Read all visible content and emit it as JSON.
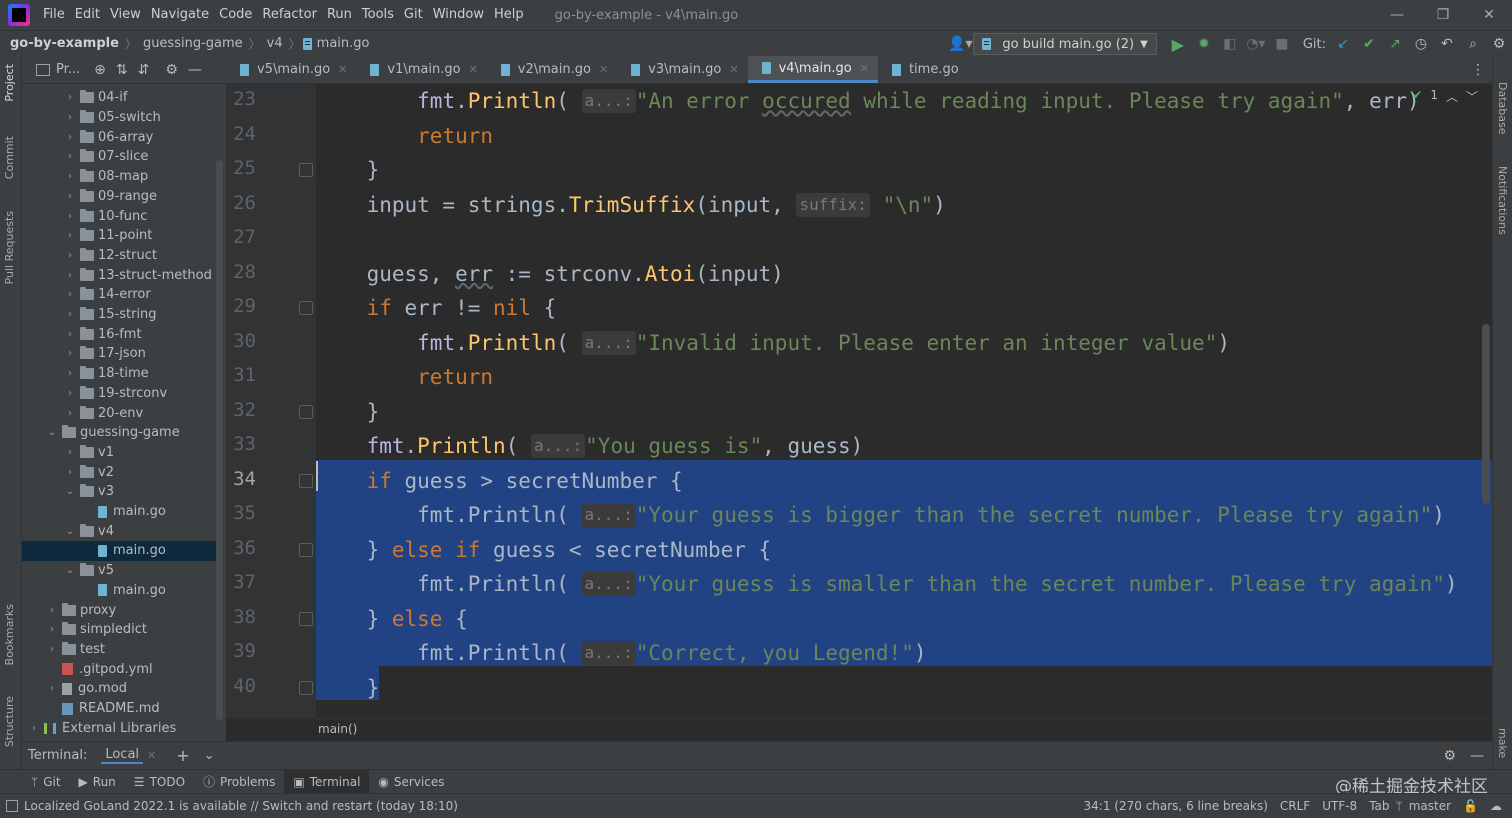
{
  "menubar": {
    "items": [
      "File",
      "Edit",
      "View",
      "Navigate",
      "Code",
      "Refactor",
      "Run",
      "Tools",
      "Git",
      "Window",
      "Help"
    ],
    "window_title": "go-by-example - v4\\main.go"
  },
  "navbar": {
    "breadcrumb": [
      "go-by-example",
      "guessing-game",
      "v4",
      "main.go"
    ],
    "run_config": "go build main.go (2)",
    "git_label": "Git:"
  },
  "left_strip": [
    "Project",
    "Commit",
    "Pull Requests",
    "Bookmarks",
    "Structure"
  ],
  "right_strip": [
    "Database",
    "Notifications",
    "make"
  ],
  "project": {
    "title": "Pr...",
    "tree": [
      {
        "label": "04-if",
        "type": "folder",
        "depth": 2,
        "arrow": "›"
      },
      {
        "label": "05-switch",
        "type": "folder",
        "depth": 2,
        "arrow": "›"
      },
      {
        "label": "06-array",
        "type": "folder",
        "depth": 2,
        "arrow": "›"
      },
      {
        "label": "07-slice",
        "type": "folder",
        "depth": 2,
        "arrow": "›"
      },
      {
        "label": "08-map",
        "type": "folder",
        "depth": 2,
        "arrow": "›"
      },
      {
        "label": "09-range",
        "type": "folder",
        "depth": 2,
        "arrow": "›"
      },
      {
        "label": "10-func",
        "type": "folder",
        "depth": 2,
        "arrow": "›"
      },
      {
        "label": "11-point",
        "type": "folder",
        "depth": 2,
        "arrow": "›"
      },
      {
        "label": "12-struct",
        "type": "folder",
        "depth": 2,
        "arrow": "›"
      },
      {
        "label": "13-struct-method",
        "type": "folder",
        "depth": 2,
        "arrow": "›"
      },
      {
        "label": "14-error",
        "type": "folder",
        "depth": 2,
        "arrow": "›"
      },
      {
        "label": "15-string",
        "type": "folder",
        "depth": 2,
        "arrow": "›"
      },
      {
        "label": "16-fmt",
        "type": "folder",
        "depth": 2,
        "arrow": "›"
      },
      {
        "label": "17-json",
        "type": "folder",
        "depth": 2,
        "arrow": "›"
      },
      {
        "label": "18-time",
        "type": "folder",
        "depth": 2,
        "arrow": "›"
      },
      {
        "label": "19-strconv",
        "type": "folder",
        "depth": 2,
        "arrow": "›"
      },
      {
        "label": "20-env",
        "type": "folder",
        "depth": 2,
        "arrow": "›"
      },
      {
        "label": "guessing-game",
        "type": "folder",
        "depth": 1,
        "arrow": "⌄"
      },
      {
        "label": "v1",
        "type": "folder",
        "depth": 2,
        "arrow": "›"
      },
      {
        "label": "v2",
        "type": "folder",
        "depth": 2,
        "arrow": "›"
      },
      {
        "label": "v3",
        "type": "folder",
        "depth": 2,
        "arrow": "⌄"
      },
      {
        "label": "main.go",
        "type": "go",
        "depth": 3,
        "arrow": ""
      },
      {
        "label": "v4",
        "type": "folder",
        "depth": 2,
        "arrow": "⌄"
      },
      {
        "label": "main.go",
        "type": "go",
        "depth": 3,
        "arrow": "",
        "selected": true
      },
      {
        "label": "v5",
        "type": "folder",
        "depth": 2,
        "arrow": "⌄"
      },
      {
        "label": "main.go",
        "type": "go",
        "depth": 3,
        "arrow": ""
      },
      {
        "label": "proxy",
        "type": "folder",
        "depth": 1,
        "arrow": "›"
      },
      {
        "label": "simpledict",
        "type": "folder",
        "depth": 1,
        "arrow": "›"
      },
      {
        "label": "test",
        "type": "folder",
        "depth": 1,
        "arrow": "›"
      },
      {
        "label": ".gitpod.yml",
        "type": "yml",
        "depth": 1,
        "arrow": ""
      },
      {
        "label": "go.mod",
        "type": "mod",
        "depth": 1,
        "arrow": "›"
      },
      {
        "label": "README.md",
        "type": "md",
        "depth": 1,
        "arrow": ""
      },
      {
        "label": "External Libraries",
        "type": "lib",
        "depth": 0,
        "arrow": "›"
      }
    ]
  },
  "tabs": [
    {
      "label": "v5\\main.go"
    },
    {
      "label": "v1\\main.go"
    },
    {
      "label": "v2\\main.go"
    },
    {
      "label": "v3\\main.go"
    },
    {
      "label": "v4\\main.go",
      "active": true
    },
    {
      "label": "time.go"
    }
  ],
  "editor": {
    "line_numbers": [
      "23",
      "24",
      "25",
      "26",
      "27",
      "28",
      "29",
      "30",
      "31",
      "32",
      "33",
      "34",
      "35",
      "36",
      "37",
      "38",
      "39",
      "40"
    ],
    "current_line": "34",
    "inspection_count": "1",
    "breadcrumb": "main()",
    "lines": [
      [
        {
          "t": "        "
        },
        {
          "t": "fmt",
          "c": "pkg"
        },
        {
          "t": "."
        },
        {
          "t": "Println",
          "c": "fn"
        },
        {
          "t": "( "
        },
        {
          "t": "a...:",
          "c": "hint"
        },
        {
          "t": "\"An error ",
          "c": "str"
        },
        {
          "t": "occured",
          "c": "str typo"
        },
        {
          "t": " while reading input. Please try again\"",
          "c": "str"
        },
        {
          "t": ", err)"
        }
      ],
      [
        {
          "t": "        "
        },
        {
          "t": "return",
          "c": "kw"
        }
      ],
      [
        {
          "t": "    }"
        }
      ],
      [
        {
          "t": "    input = strings."
        },
        {
          "t": "TrimSuffix",
          "c": "fn"
        },
        {
          "t": "(input, "
        },
        {
          "t": "suffix:",
          "c": "hint"
        },
        {
          "t": " "
        },
        {
          "t": "\"\\n\"",
          "c": "str"
        },
        {
          "t": ")"
        }
      ],
      [
        {
          "t": ""
        }
      ],
      [
        {
          "t": "    guess, "
        },
        {
          "t": "err",
          "c": "typo"
        },
        {
          "t": " := strconv."
        },
        {
          "t": "Atoi",
          "c": "fn"
        },
        {
          "t": "(input)"
        }
      ],
      [
        {
          "t": "    "
        },
        {
          "t": "if",
          "c": "kw"
        },
        {
          "t": " err != "
        },
        {
          "t": "nil",
          "c": "kw"
        },
        {
          "t": " {"
        }
      ],
      [
        {
          "t": "        "
        },
        {
          "t": "fmt",
          "c": "pkg"
        },
        {
          "t": "."
        },
        {
          "t": "Println",
          "c": "fn"
        },
        {
          "t": "( "
        },
        {
          "t": "a...:",
          "c": "hint"
        },
        {
          "t": "\"Invalid input. Please enter an integer value\"",
          "c": "str"
        },
        {
          "t": ")"
        }
      ],
      [
        {
          "t": "        "
        },
        {
          "t": "return",
          "c": "kw"
        }
      ],
      [
        {
          "t": "    }"
        }
      ],
      [
        {
          "t": "    "
        },
        {
          "t": "fmt",
          "c": "pkg"
        },
        {
          "t": "."
        },
        {
          "t": "Println",
          "c": "fn"
        },
        {
          "t": "( "
        },
        {
          "t": "a...:",
          "c": "hint"
        },
        {
          "t": "\"You guess is\"",
          "c": "str"
        },
        {
          "t": ", guess)"
        }
      ],
      [
        {
          "t": "    "
        },
        {
          "t": "if",
          "c": "kw"
        },
        {
          "t": " guess > secretNumber {"
        }
      ],
      [
        {
          "t": "        fmt."
        },
        {
          "t": "Println",
          "c": ""
        },
        {
          "t": "( "
        },
        {
          "t": "a...:",
          "c": "hint"
        },
        {
          "t": "\"Your guess is bigger than the secret number. Please try again\"",
          "c": "str"
        },
        {
          "t": ")"
        }
      ],
      [
        {
          "t": "    } "
        },
        {
          "t": "else if",
          "c": "kw"
        },
        {
          "t": " guess < secretNumber {"
        }
      ],
      [
        {
          "t": "        fmt.Println( "
        },
        {
          "t": "a...:",
          "c": "hint"
        },
        {
          "t": "\"Your guess is smaller than the secret number. Please try again\"",
          "c": "str"
        },
        {
          "t": ")"
        }
      ],
      [
        {
          "t": "    } "
        },
        {
          "t": "else",
          "c": "kw"
        },
        {
          "t": " {"
        }
      ],
      [
        {
          "t": "        fmt.Println( "
        },
        {
          "t": "a...:",
          "c": "hint"
        },
        {
          "t": "\"Correct, you Legend!\"",
          "c": "str"
        },
        {
          "t": ")"
        }
      ],
      [
        {
          "t": "    }"
        }
      ]
    ]
  },
  "terminal": {
    "label": "Terminal:",
    "tab": "Local"
  },
  "bottom_tabs": [
    {
      "label": "Git",
      "icon": "git-branch-icon"
    },
    {
      "label": "Run",
      "icon": "run-icon"
    },
    {
      "label": "TODO",
      "icon": "todo-icon"
    },
    {
      "label": "Problems",
      "icon": "problems-icon"
    },
    {
      "label": "Terminal",
      "icon": "terminal-icon",
      "active": true
    },
    {
      "label": "Services",
      "icon": "services-icon"
    }
  ],
  "status": {
    "message": "Localized GoLand 2022.1 is available // Switch and restart (today 18:10)",
    "position": "34:1 (270 chars, 6 line breaks)",
    "line_ending": "CRLF",
    "encoding": "UTF-8",
    "indent": "Tab",
    "branch": "master"
  },
  "watermark": "@稀土掘金技术社区",
  "colors": {
    "selection": "#214283",
    "keyword": "#cc7832",
    "string": "#6a8759",
    "function": "#ffc66d",
    "accent": "#4a88c7"
  }
}
